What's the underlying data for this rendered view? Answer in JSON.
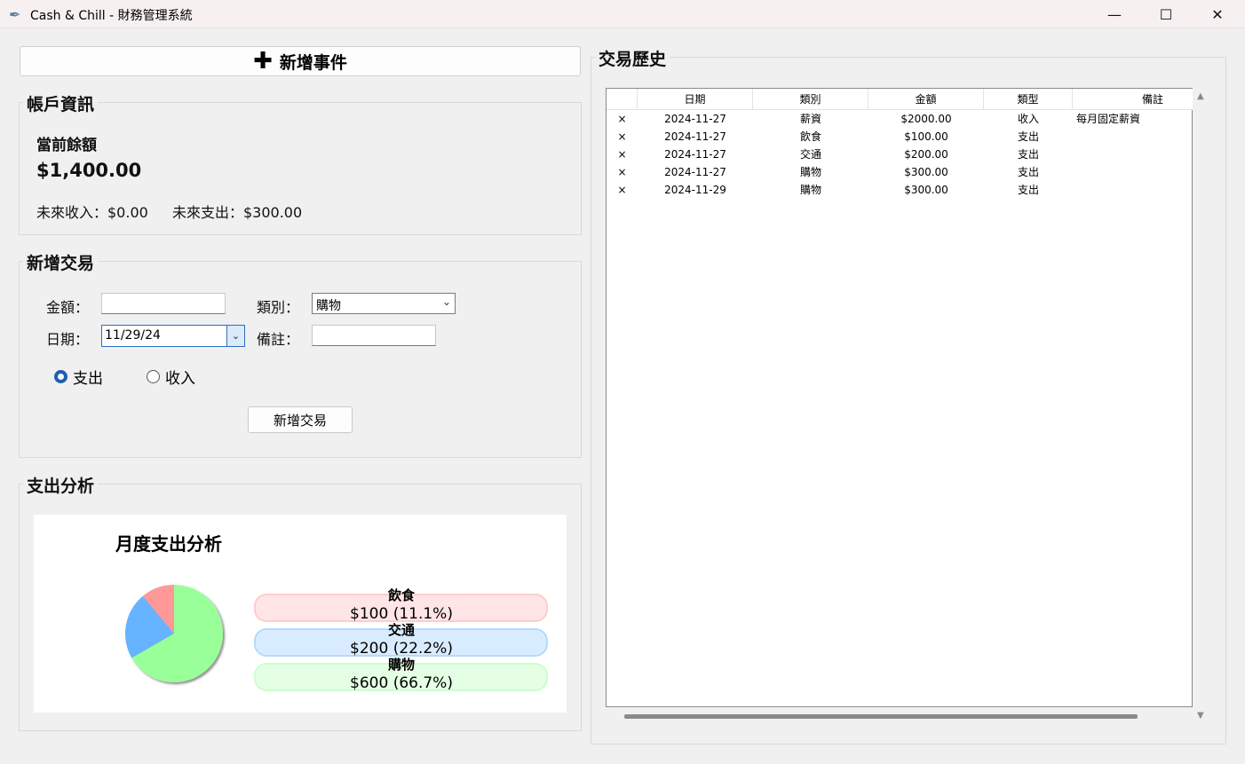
{
  "window": {
    "title": "Cash & Chill - 財務管理系統",
    "icons": {
      "app": "feather-icon",
      "minimize": "minimize-icon",
      "maximize": "maximize-icon",
      "close": "close-icon"
    }
  },
  "toolbar": {
    "add_event_label": "新增事件",
    "add_event_icon": "plus-icon"
  },
  "account": {
    "title": "帳戶資訊",
    "balance_label": "當前餘額",
    "balance_value": "$1,400.00",
    "future_income": "未來收入：$0.00",
    "future_expense": "未來支出：$300.00"
  },
  "new_transaction": {
    "title": "新增交易",
    "amount_label": "金額：",
    "amount_value": "",
    "category_label": "類別：",
    "category_value": "購物",
    "date_label": "日期：",
    "date_value": "11/29/24",
    "note_label": "備註：",
    "note_value": "",
    "radio_expense": "支出",
    "radio_income": "收入",
    "selected_type": "支出",
    "submit_label": "新增交易"
  },
  "analysis": {
    "title": "支出分析",
    "colors": {
      "飲食": "#ff9999",
      "交通": "#66b3ff",
      "購物": "#99ff99"
    }
  },
  "chart_data": {
    "type": "pie",
    "title": "月度支出分析",
    "categories": [
      "飲食",
      "交通",
      "購物"
    ],
    "values": [
      100,
      200,
      600
    ],
    "labels": [
      "$100 (11.1%)",
      "$200 (22.2%)",
      "$600 (66.7%)"
    ],
    "legend": "right"
  },
  "history": {
    "title": "交易歷史",
    "columns": [
      "日期",
      "類別",
      "金額",
      "類型",
      "備註"
    ],
    "delete_symbol": "×",
    "rows": [
      {
        "date": "2024-11-27",
        "category": "薪資",
        "amount": "$2000.00",
        "type": "收入",
        "note": "每月固定薪資"
      },
      {
        "date": "2024-11-27",
        "category": "飲食",
        "amount": "$100.00",
        "type": "支出",
        "note": ""
      },
      {
        "date": "2024-11-27",
        "category": "交通",
        "amount": "$200.00",
        "type": "支出",
        "note": ""
      },
      {
        "date": "2024-11-27",
        "category": "購物",
        "amount": "$300.00",
        "type": "支出",
        "note": ""
      },
      {
        "date": "2024-11-29",
        "category": "購物",
        "amount": "$300.00",
        "type": "支出",
        "note": ""
      }
    ]
  }
}
